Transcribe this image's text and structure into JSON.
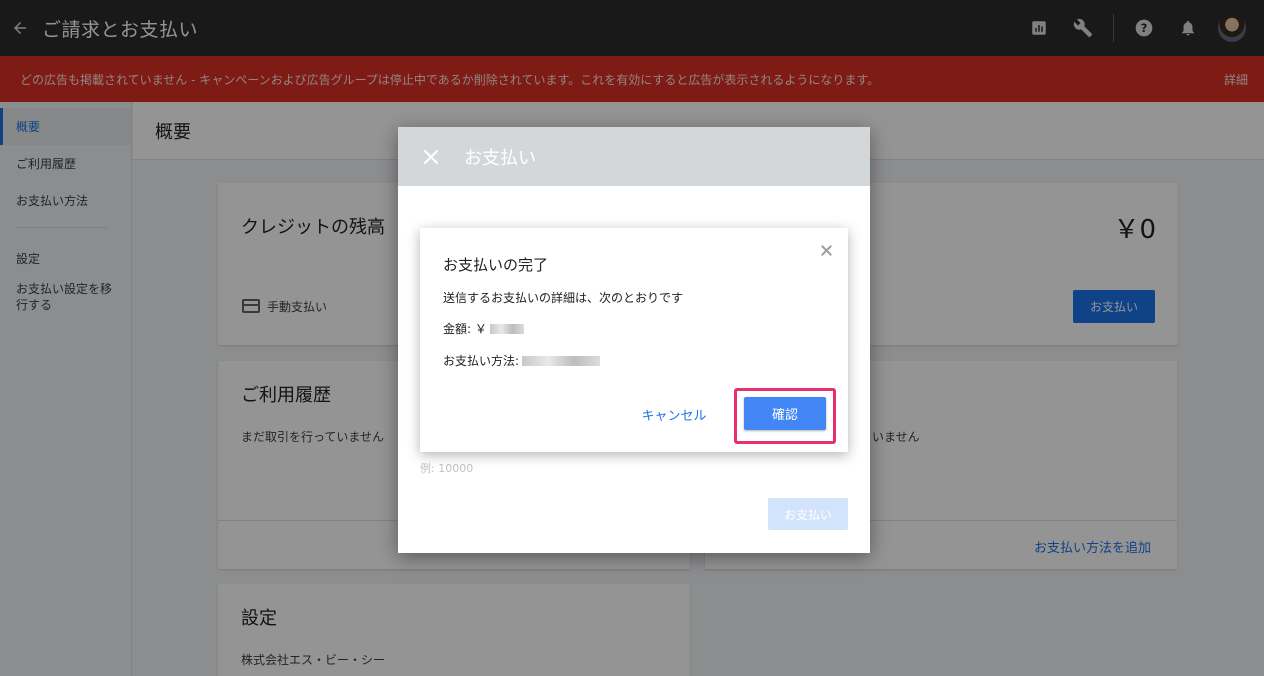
{
  "header": {
    "title": "ご請求とお支払い"
  },
  "banner": {
    "text": "どの広告も掲載されていません - キャンペーンおよび広告グループは停止中であるか削除されています。これを有効にすると広告が表示されるようになります。",
    "link": "詳細"
  },
  "sidebar": {
    "items": [
      {
        "label": "概要"
      },
      {
        "label": "ご利用履歴"
      },
      {
        "label": "お支払い方法"
      },
      {
        "label": "設定"
      },
      {
        "label": "お支払い設定を移行する"
      }
    ]
  },
  "page": {
    "title": "概要"
  },
  "credit_card": {
    "title": "クレジットの残高",
    "amount": "￥0",
    "manual_pay": "手動支払い",
    "pay_button": "お支払い"
  },
  "history_card": {
    "title": "ご利用履歴",
    "empty": "まだ取引を行っていません"
  },
  "methods_card": {
    "empty_suffix": "いません",
    "add_link": "お支払い方法を追加"
  },
  "settings_card": {
    "title": "設定",
    "company": "株式会社エス・ビー・シー"
  },
  "payment_dialog": {
    "title": "お支払い",
    "hint": "例: 10000",
    "pay_button": "お支払い"
  },
  "confirm_dialog": {
    "title": "お支払いの完了",
    "description": "送信するお支払いの詳細は、次のとおりです",
    "amount_label": "金額: ￥",
    "method_label": "お支払い方法:",
    "cancel": "キャンセル",
    "confirm": "確認"
  },
  "colors": {
    "accent": "#1a73e8",
    "banner": "#d93025",
    "highlight": "#e8306e"
  }
}
